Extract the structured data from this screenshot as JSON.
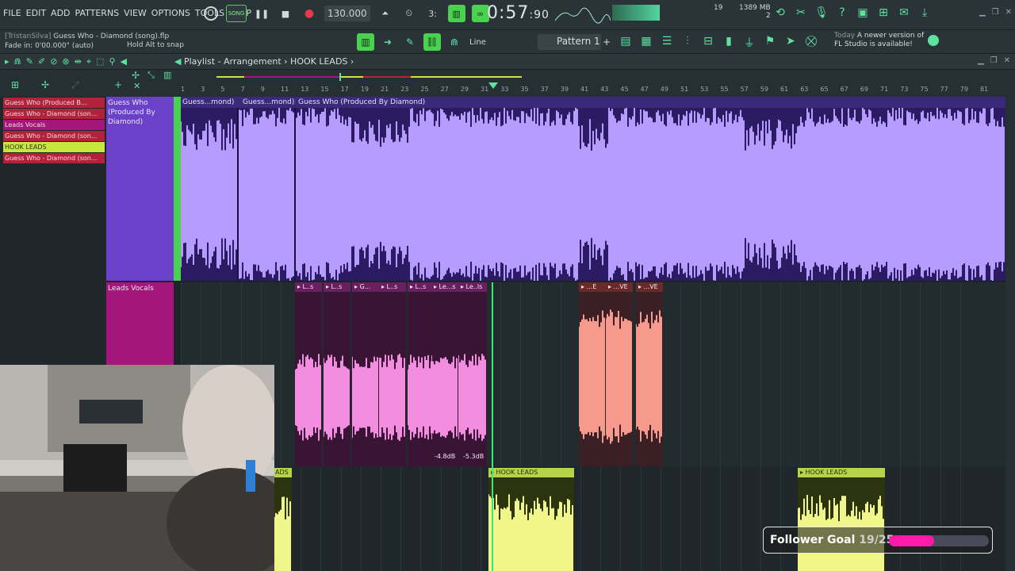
{
  "menu": [
    "FILE",
    "EDIT",
    "ADD",
    "PATTERNS",
    "VIEW",
    "OPTIONS",
    "TOOLS",
    "HELP"
  ],
  "transport": {
    "song_label": "SONG",
    "tempo": "130.000",
    "time": "0:57",
    "time_small": ":90",
    "cpu": "19",
    "mem": "1389 MB",
    "mem_sub": "2"
  },
  "hint": {
    "line1_user": "[TristanSilva]",
    "line1": "Guess Who - Diamond (song).flp",
    "line2": "Fade in:",
    "line2_value": "0'00.000\" (auto)",
    "snap_hint": "Hold Alt to snap"
  },
  "snap": {
    "label": "Line"
  },
  "pattern": {
    "selected": "Pattern 1",
    "add": "+"
  },
  "news": {
    "today": "Today",
    "line1": "A newer version of",
    "line2": "FL Studio is available!"
  },
  "playlist": {
    "title": "Playlist - Arrangement",
    "separator": "›",
    "current": "HOOK LEADS",
    "tail": "›"
  },
  "ruler_ticks": [
    "1",
    "3",
    "5",
    "7",
    "9",
    "11",
    "13",
    "15",
    "17",
    "19",
    "21",
    "23",
    "25",
    "27",
    "29",
    "31",
    "33",
    "35",
    "37",
    "39",
    "41",
    "43",
    "45",
    "47",
    "49",
    "51",
    "53",
    "55",
    "57",
    "59",
    "61",
    "63",
    "65",
    "67",
    "69",
    "71",
    "73",
    "75",
    "77",
    "79",
    "81"
  ],
  "patterns": [
    {
      "label": "Guess Who (Produced B...",
      "color": "red"
    },
    {
      "label": "Guess Who - Diamond (son...",
      "color": "red"
    },
    {
      "label": "Leads Vocals",
      "color": "magenta"
    },
    {
      "label": "Guess Who - Diamond (son...",
      "color": "red"
    },
    {
      "label": "HOOK LEADS",
      "color": "lime"
    },
    {
      "label": "Guess Who - Diamond (son...",
      "color": "red"
    }
  ],
  "tracks": [
    {
      "name": "Guess Who (Produced By Diamond)"
    },
    {
      "name": "Leads Vocals"
    }
  ],
  "lane1_clips": [
    "Guess...mond)",
    "Guess...mond)",
    "Guess Who (Produced By Diamond)"
  ],
  "lane2_clips": [
    "L..s",
    "L..s",
    "G...",
    "L..s",
    "L..s",
    "Le...s",
    "Le..ls",
    "...E",
    "...VE",
    "...VE"
  ],
  "db_labels": [
    "-4.8dB",
    "-5.3dB"
  ],
  "lane3_clips": [
    "ADS",
    "HOOK LEADS",
    "HOOK LEADS"
  ],
  "follower": {
    "label": "Follower Goal",
    "count": "19/25",
    "progress": 0.45
  },
  "colors": {
    "accent": "#5fe2a0",
    "green": "#4ad14f",
    "purple_clip": "#b79cff",
    "pink_clip": "#f28de0",
    "salmon_clip": "#f59a8c",
    "yellow_clip": "#f0f68a"
  }
}
